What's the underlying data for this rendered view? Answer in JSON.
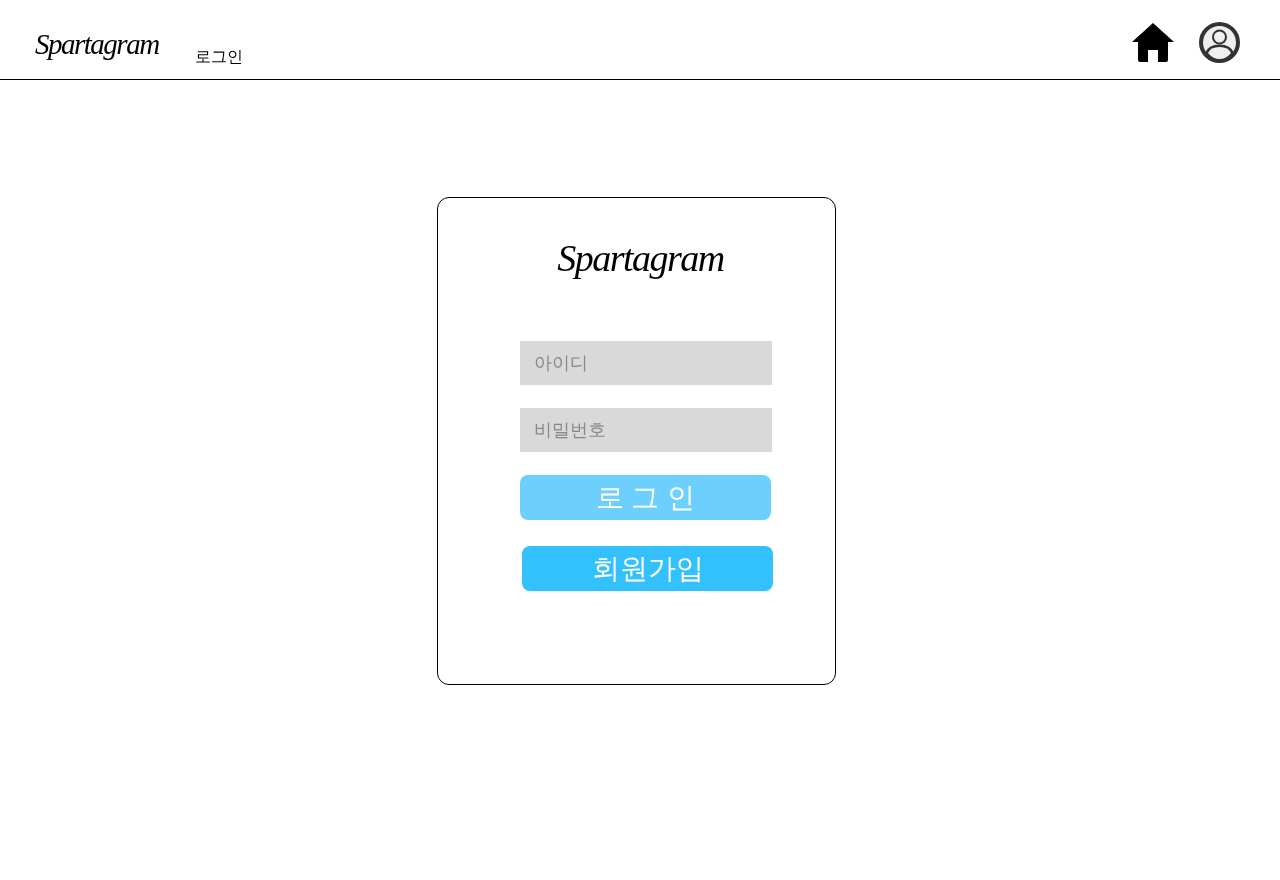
{
  "header": {
    "logo": "Spartagram",
    "title": "로그인"
  },
  "login_card": {
    "logo": "Spartagram",
    "fields": [
      {
        "placeholder": "아이디"
      },
      {
        "placeholder": "비밀번호"
      }
    ],
    "buttons": [
      {
        "label": "로 그 인",
        "disabled": true
      },
      {
        "label": "회원가입",
        "disabled": false
      }
    ]
  }
}
